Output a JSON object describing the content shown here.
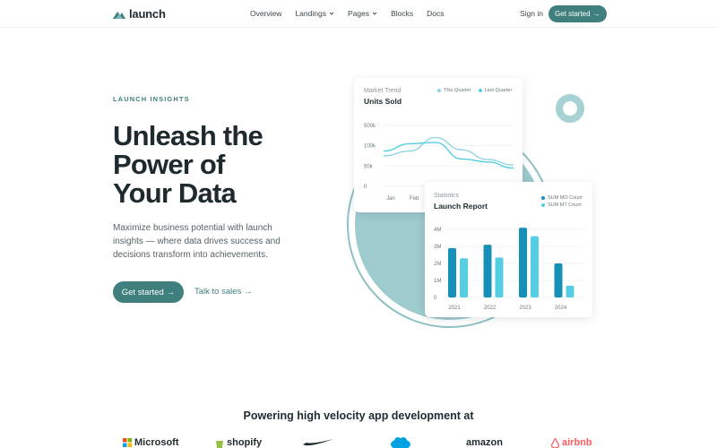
{
  "nav": {
    "brand": "launch",
    "links": [
      {
        "label": "Overview",
        "dropdown": false
      },
      {
        "label": "Landings",
        "dropdown": true
      },
      {
        "label": "Pages",
        "dropdown": true
      },
      {
        "label": "Blocks",
        "dropdown": false
      },
      {
        "label": "Docs",
        "dropdown": false
      }
    ],
    "signin": "Sign in",
    "cta": "Get started",
    "arrow": "→"
  },
  "hero": {
    "eyebrow": "LAUNCH INSIGHTS",
    "headline_lines": [
      "Unleash the",
      "Power of",
      "Your Data"
    ],
    "subtitle": "Maximize business potential with launch insights — where data drives success and decisions transform into achievements.",
    "primary_cta": "Get started",
    "secondary_cta": "Talk to sales",
    "arrow": "→"
  },
  "colors": {
    "accent": "#3f7f7d",
    "teal_light": "#9ecbce",
    "series_dark": "#1690b6",
    "series_light": "#55cde2"
  },
  "trend_card": {
    "kicker": "Market Trend",
    "title": "Units Sold",
    "legend": [
      "This Quarter",
      "Last Quarter"
    ]
  },
  "report_card": {
    "kicker": "Statistics",
    "title": "Launch Report",
    "legend": [
      "SUM MO Count",
      "SUM MT Count"
    ]
  },
  "chart_data": [
    {
      "type": "line",
      "title": "Units Sold",
      "subtitle": "Market Trend",
      "y_ticks": [
        "500k",
        "100k",
        "50k",
        "0"
      ],
      "x_ticks": [
        "Jan",
        "Feb"
      ],
      "series": [
        {
          "name": "This Quarter",
          "color": "#8fd5df",
          "y": [
            0.5,
            0.58,
            0.8,
            0.6,
            0.44,
            0.35
          ]
        },
        {
          "name": "Last Quarter",
          "color": "#55cde2",
          "y": [
            0.58,
            0.7,
            0.72,
            0.45,
            0.4,
            0.3
          ]
        }
      ],
      "grid": true
    },
    {
      "type": "bar",
      "title": "Launch Report",
      "subtitle": "Statistics",
      "categories": [
        "2021",
        "2022",
        "2023",
        "2024"
      ],
      "y_ticks": [
        "4M",
        "3M",
        "2M",
        "1M",
        "0"
      ],
      "ylim": [
        0,
        4000000
      ],
      "series": [
        {
          "name": "SUM MO Count",
          "color": "#1690b6",
          "values": [
            2900000,
            3100000,
            4100000,
            2000000
          ]
        },
        {
          "name": "SUM MT Count",
          "color": "#55cde2",
          "values": [
            2300000,
            2350000,
            3600000,
            700000
          ]
        }
      ],
      "grid": true
    }
  ],
  "logos": {
    "heading": "Powering high velocity app development at",
    "brands": [
      "Microsoft",
      "shopify",
      "nike",
      "salesforce",
      "amazon",
      "airbnb"
    ]
  }
}
